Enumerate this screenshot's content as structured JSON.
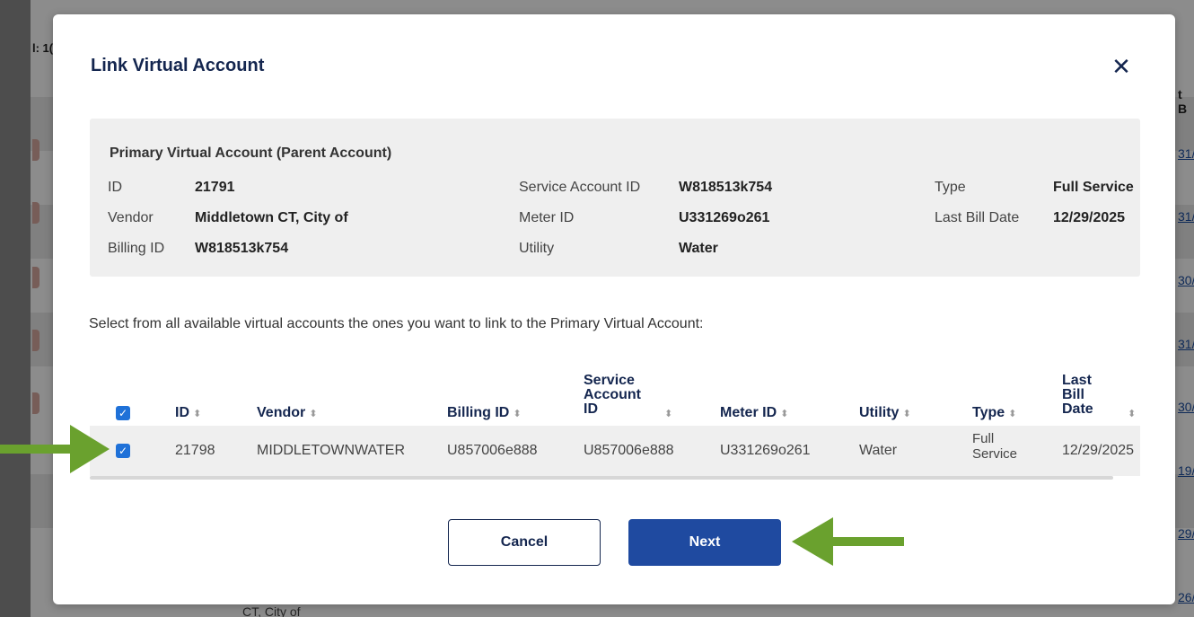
{
  "background": {
    "total_label": "l: 1(",
    "column_header": "t B",
    "dates": [
      "31/",
      "31/",
      "30/",
      "31/",
      "30/",
      "19/",
      "29/",
      "26/"
    ],
    "bottom_row_text": [
      "CT, City of"
    ]
  },
  "modal": {
    "title": "Link Virtual Account",
    "close_icon": "close-icon"
  },
  "primary": {
    "heading": "Primary Virtual Account (Parent Account)",
    "fields": {
      "id_label": "ID",
      "id_value": "21791",
      "vendor_label": "Vendor",
      "vendor_value": "Middletown CT, City of",
      "billing_label": "Billing ID",
      "billing_value": "W818513k754",
      "service_label": "Service Account ID",
      "service_value": "W818513k754",
      "meter_label": "Meter ID",
      "meter_value": "U331269o261",
      "utility_label": "Utility",
      "utility_value": "Water",
      "type_label": "Type",
      "type_value": "Full Service",
      "lastbill_label": "Last Bill Date",
      "lastbill_value": "12/29/2025"
    }
  },
  "instruction": "Select from all available virtual accounts the ones you want to link to the Primary Virtual Account:",
  "table": {
    "headers": {
      "id": "ID",
      "vendor": "Vendor",
      "billing": "Billing ID",
      "service_line1": "Service",
      "service_line2": "Account",
      "service_line3": "ID",
      "meter": "Meter ID",
      "utility": "Utility",
      "type": "Type",
      "lastbill_line1": "Last",
      "lastbill_line2": "Bill",
      "lastbill_line3": "Date"
    },
    "rows": [
      {
        "checked": true,
        "id": "21798",
        "vendor": "MIDDLETOWNWATER",
        "billing": "U857006e888",
        "service": "U857006e888",
        "meter": "U331269o261",
        "utility": "Water",
        "type_line1": "Full",
        "type_line2": "Service",
        "lastbill": "12/29/2025"
      }
    ]
  },
  "buttons": {
    "cancel": "Cancel",
    "next": "Next"
  },
  "colors": {
    "accent": "#1f4aa0",
    "checkbox": "#1f71d8",
    "arrow": "#6aa12e",
    "title": "#14264f"
  }
}
